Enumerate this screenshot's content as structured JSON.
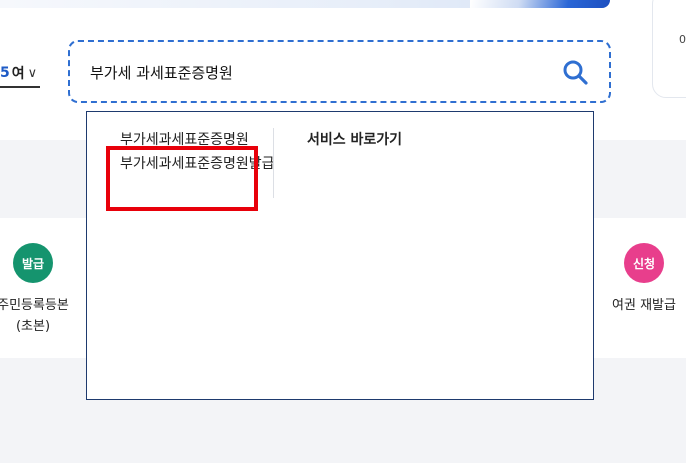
{
  "side_card": {
    "text": "0"
  },
  "year_select": {
    "number": "5",
    "unit": "여",
    "chevron_glyph": "∨"
  },
  "search": {
    "value": "부가세 과세표준증명원"
  },
  "autocomplete": {
    "suggestions": [
      {
        "label": "부가세과세표준증명원"
      },
      {
        "label": "부가세과세표준증명원발급"
      }
    ],
    "heading": "서비스 바로가기"
  },
  "services": {
    "left": {
      "badge": "발급",
      "label": "주민등록등본(초본)",
      "badge_color": "#15946e"
    },
    "right": {
      "badge": "신청",
      "label": "여권 재발급",
      "badge_color": "#e83e8c"
    }
  },
  "colors": {
    "accent": "#2f6fd1",
    "highlight": "#e8000a"
  }
}
